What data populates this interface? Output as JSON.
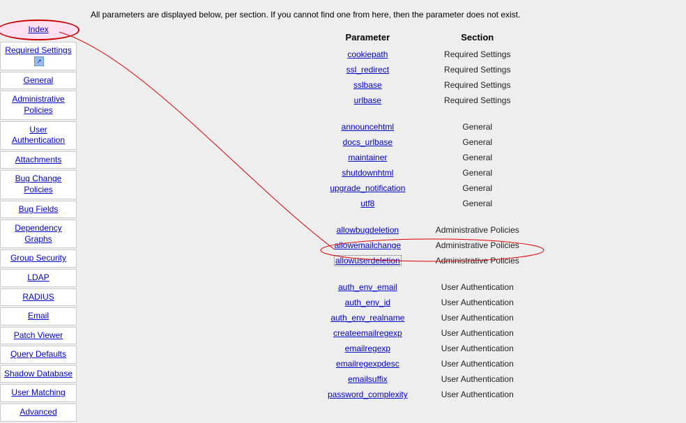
{
  "intro": "All parameters are displayed below, per section. If you cannot find one from here, then the parameter does not exist.",
  "sidebar": {
    "items": [
      "Index",
      "Required Settings",
      "General",
      "Administrative Policies",
      "User Authentication",
      "Attachments",
      "Bug Change Policies",
      "Bug Fields",
      "Dependency Graphs",
      "Group Security",
      "LDAP",
      "RADIUS",
      "Email",
      "Patch Viewer",
      "Query Defaults",
      "Shadow Database",
      "User Matching",
      "Advanced"
    ]
  },
  "table": {
    "headers": {
      "parameter": "Parameter",
      "section": "Section"
    },
    "groups": [
      {
        "section": "Required Settings",
        "params": [
          "cookiepath",
          "ssl_redirect",
          "sslbase",
          "urlbase"
        ]
      },
      {
        "section": "General",
        "params": [
          "announcehtml",
          "docs_urlbase",
          "maintainer",
          "shutdownhtml",
          "upgrade_notification",
          "utf8"
        ]
      },
      {
        "section": "Administrative Policies",
        "params": [
          "allowbugdeletion",
          "allowemailchange",
          "allowuserdeletion"
        ]
      },
      {
        "section": "User Authentication",
        "params": [
          "auth_env_email",
          "auth_env_id",
          "auth_env_realname",
          "createemailregexp",
          "emailregexp",
          "emailregexpdesc",
          "emailsuffix",
          "password_complexity"
        ]
      }
    ]
  },
  "annotation": {
    "circled_sidebar": "Index",
    "circled_param": "allowuserdeletion"
  }
}
